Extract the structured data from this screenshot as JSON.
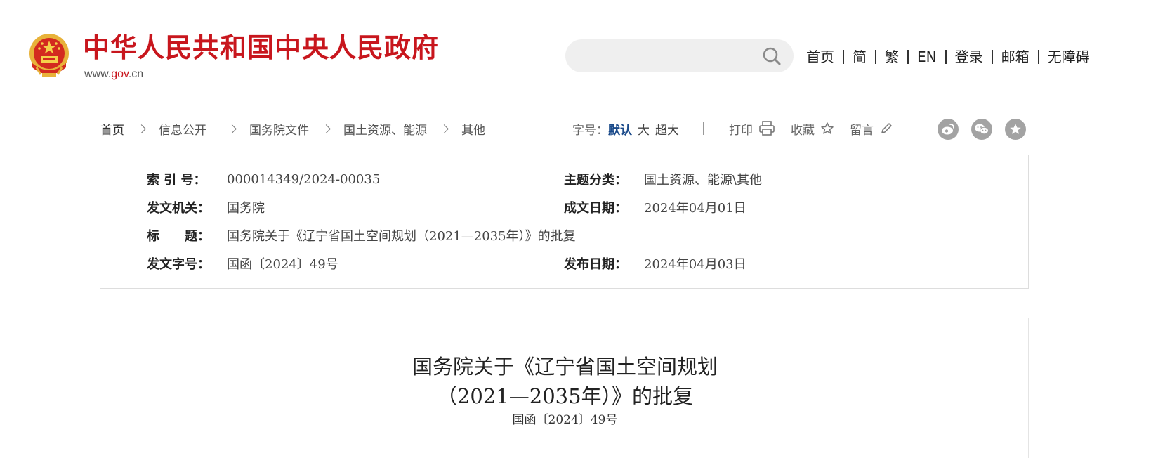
{
  "header": {
    "site_title": "中华人民共和国中央人民政府",
    "site_url_prefix": "www.",
    "site_url_accent": "gov",
    "site_url_suffix": ".cn",
    "brand_color": "#c8161d",
    "search": {
      "placeholder": "",
      "value": ""
    },
    "nav": [
      "首页",
      "简",
      "繁",
      "EN",
      "登录",
      "邮箱",
      "无障碍"
    ]
  },
  "breadcrumb": [
    "首页",
    "信息公开",
    "国务院文件",
    "国土资源、能源",
    "其他"
  ],
  "toolbar": {
    "font_size_label": "字号：",
    "font_sizes": [
      "默认",
      "大",
      "超大"
    ],
    "print_label": "打印",
    "favorite_label": "收藏",
    "comment_label": "留言",
    "share_icons": [
      "weibo-icon",
      "wechat-icon",
      "star-icon"
    ]
  },
  "info": {
    "index_no_label": "索 引 号：",
    "index_no": "000014349/2024-00035",
    "topic_label": "主题分类：",
    "topic": "国土资源、能源\\其他",
    "issuer_label": "发文机关：",
    "issuer": "国务院",
    "written_date_label": "成文日期：",
    "written_date": "2024年04月01日",
    "title_label": "标　　题：",
    "title": "国务院关于《辽宁省国土空间规划（2021—2035年）》的批复",
    "doc_no_label": "发文字号：",
    "doc_no": "国函〔2024〕49号",
    "publish_date_label": "发布日期：",
    "publish_date": "2024年04月03日"
  },
  "article": {
    "title_line1": "国务院关于《辽宁省国土空间规划",
    "title_line2": "（2021—2035年）》的批复",
    "doc_no": "国函〔2024〕49号"
  }
}
